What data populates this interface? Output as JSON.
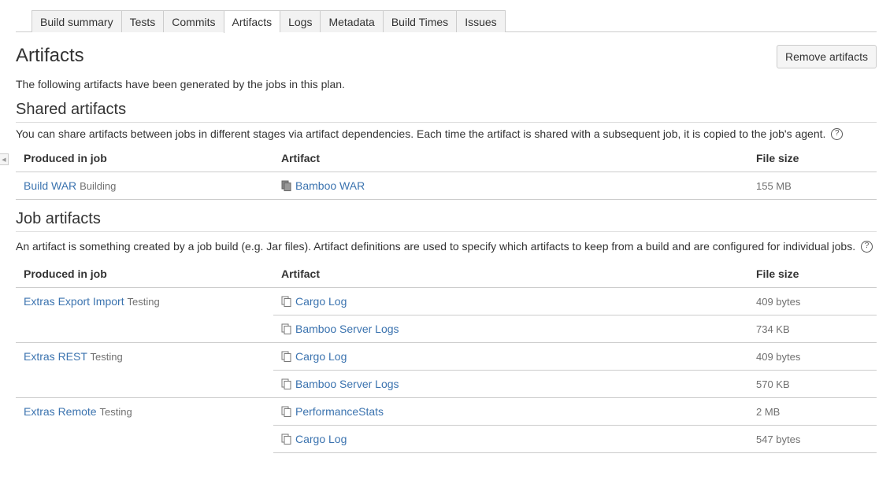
{
  "tabs": [
    {
      "label": "Build summary",
      "active": false
    },
    {
      "label": "Tests",
      "active": false
    },
    {
      "label": "Commits",
      "active": false
    },
    {
      "label": "Artifacts",
      "active": true
    },
    {
      "label": "Logs",
      "active": false
    },
    {
      "label": "Metadata",
      "active": false
    },
    {
      "label": "Build Times",
      "active": false
    },
    {
      "label": "Issues",
      "active": false
    }
  ],
  "header": {
    "title": "Artifacts",
    "remove_label": "Remove artifacts",
    "intro": "The following artifacts have been generated by the jobs in this plan."
  },
  "shared": {
    "title": "Shared artifacts",
    "description": "You can share artifacts between jobs in different stages via artifact dependencies. Each time the artifact is shared with a subsequent job, it is copied to the job's agent.",
    "help_glyph": "?",
    "columns": {
      "job": "Produced in job",
      "artifact": "Artifact",
      "size": "File size"
    },
    "rows": [
      {
        "job": "Build WAR",
        "stage": "Building",
        "artifact": "Bamboo WAR",
        "size": "155 MB"
      }
    ]
  },
  "job_artifacts": {
    "title": "Job artifacts",
    "description": "An artifact is something created by a job build (e.g. Jar files). Artifact definitions are used to specify which artifacts to keep from a build and are configured for individual jobs.",
    "help_glyph": "?",
    "columns": {
      "job": "Produced in job",
      "artifact": "Artifact",
      "size": "File size"
    },
    "groups": [
      {
        "job": "Extras Export Import",
        "stage": "Testing",
        "items": [
          {
            "artifact": "Cargo Log",
            "size": "409 bytes"
          },
          {
            "artifact": "Bamboo Server Logs",
            "size": "734 KB"
          }
        ]
      },
      {
        "job": "Extras REST",
        "stage": "Testing",
        "items": [
          {
            "artifact": "Cargo Log",
            "size": "409 bytes"
          },
          {
            "artifact": "Bamboo Server Logs",
            "size": "570 KB"
          }
        ]
      },
      {
        "job": "Extras Remote",
        "stage": "Testing",
        "items": [
          {
            "artifact": "PerformanceStats",
            "size": "2 MB"
          },
          {
            "artifact": "Cargo Log",
            "size": "547 bytes"
          }
        ]
      }
    ]
  },
  "colors": {
    "link": "#3b73af",
    "muted": "#707070",
    "border": "#cccccc"
  },
  "icons": {
    "shared_artifact": "shared-artifact-icon",
    "job_artifact": "file-icon",
    "help": "help-icon",
    "collapse": "collapse-arrow-icon"
  }
}
